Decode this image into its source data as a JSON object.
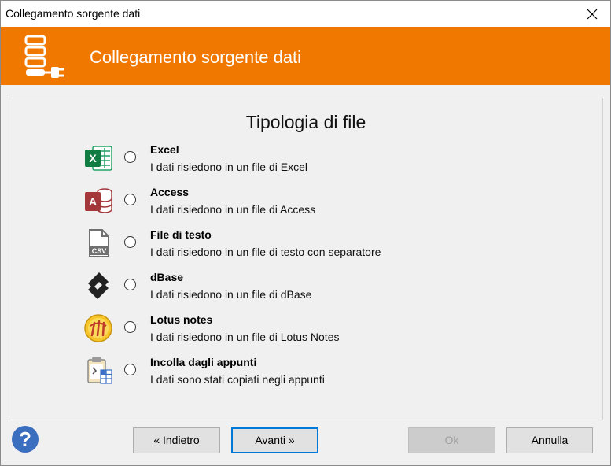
{
  "window": {
    "title": "Collegamento sorgente dati",
    "close_icon": "close-icon"
  },
  "banner": {
    "heading": "Collegamento sorgente dati",
    "bg_color": "#f07800",
    "logo_icon": "data-source-plug-icon"
  },
  "panel": {
    "title": "Tipologia di file",
    "options": [
      {
        "name": "Excel",
        "description": "I dati risiedono in un file di Excel",
        "icon": "excel-icon"
      },
      {
        "name": "Access",
        "description": "I dati risiedono in un file di Access",
        "icon": "access-icon"
      },
      {
        "name": "File di testo",
        "description": "I dati risiedono in un file di testo con separatore",
        "icon": "csv-file-icon",
        "icon_label": "CSV"
      },
      {
        "name": "dBase",
        "description": "I dati risiedono in un file di dBase",
        "icon": "dbase-icon"
      },
      {
        "name": "Lotus notes",
        "description": "I dati risiedono in un file di Lotus Notes",
        "icon": "lotus-notes-icon"
      },
      {
        "name": "Incolla dagli appunti",
        "description": "I dati sono stati copiati negli appunti",
        "icon": "clipboard-icon"
      }
    ]
  },
  "footer": {
    "help_icon": "help-icon",
    "back_label": "« Indietro",
    "next_label": "Avanti »",
    "ok_label": "Ok",
    "cancel_label": "Annulla"
  }
}
